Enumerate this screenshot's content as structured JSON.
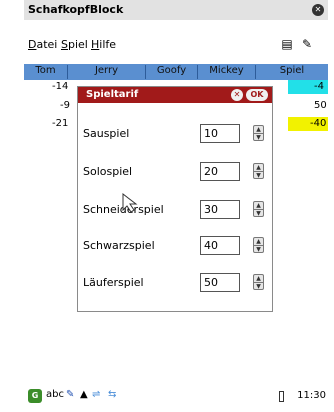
{
  "app": {
    "title": "SchafkopfBlock"
  },
  "menu": {
    "items": [
      "Datei",
      "Spiel",
      "Hilfe"
    ]
  },
  "grid": {
    "columns": [
      "Tom",
      "Jerry",
      "Goofy",
      "Mickey",
      "Spiel"
    ],
    "left_scores": [
      "-14",
      "-9",
      "-21"
    ],
    "right_scores": [
      "-4",
      "50",
      "-40"
    ],
    "colors": {
      "header": "#5a8fd0",
      "cyan_row": "#22e0e8",
      "yellow_row": "#f2f200"
    }
  },
  "dialog": {
    "title": "Spieltarif",
    "ok_label": "OK",
    "title_color": "#a11a1a",
    "fields": [
      {
        "label": "Sauspiel",
        "value": "10"
      },
      {
        "label": "Solospiel",
        "value": "20"
      },
      {
        "label": "Schneiderspiel",
        "value": "30"
      },
      {
        "label": "Schwarzspiel",
        "value": "40"
      },
      {
        "label": "Läuferspiel",
        "value": "50"
      }
    ]
  },
  "taskbar": {
    "input_mode": "abc",
    "time": "11:30"
  }
}
